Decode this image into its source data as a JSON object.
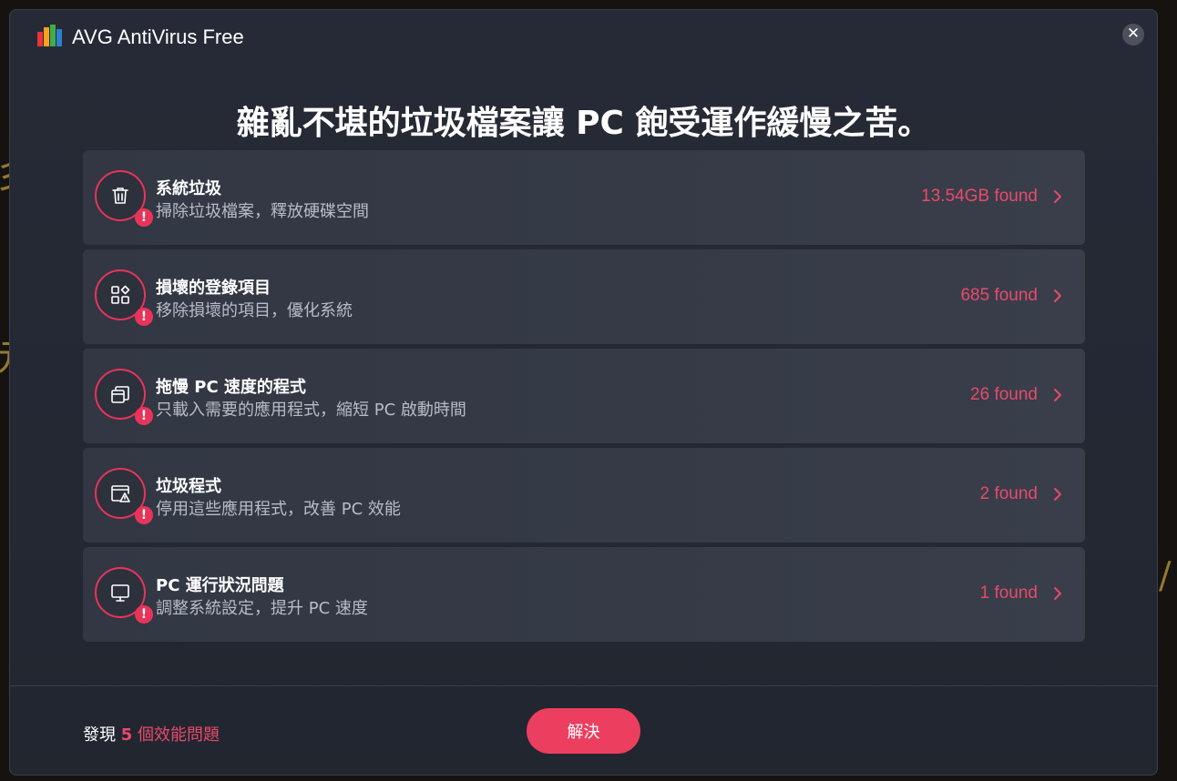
{
  "app": {
    "title": "AVG AntiVirus Free",
    "close_label": "✕"
  },
  "headline": "雜亂不堪的垃圾檔案讓 PC 飽受運作緩慢之苦。",
  "items": [
    {
      "icon": "trash-icon",
      "title": "系統垃圾",
      "desc": "掃除垃圾檔案，釋放硬碟空間",
      "count": "13.54GB found",
      "badge": "!"
    },
    {
      "icon": "registry-blocks-icon",
      "title": "損壞的登錄項目",
      "desc": "移除損壞的項目，優化系統",
      "count": "685 found",
      "badge": "!"
    },
    {
      "icon": "windows-stack-icon",
      "title": "拖慢 PC 速度的程式",
      "desc": "只載入需要的應用程式，縮短 PC 啟動時間",
      "count": "26 found",
      "badge": "!"
    },
    {
      "icon": "app-warning-icon",
      "title": "垃圾程式",
      "desc": "停用這些應用程式，改善 PC 效能",
      "count": "2 found",
      "badge": "!"
    },
    {
      "icon": "monitor-icon",
      "title": "PC 運行狀況問題",
      "desc": "調整系統設定，提升 PC 速度",
      "count": "1 found",
      "badge": "!"
    }
  ],
  "footer": {
    "prefix": "發現",
    "count": "5",
    "suffix": "個效能問題",
    "resolve_label": "解決"
  },
  "colors": {
    "accent": "#ec3e5f",
    "window_bg": "#262a36",
    "card_bg": "#353a46"
  }
}
